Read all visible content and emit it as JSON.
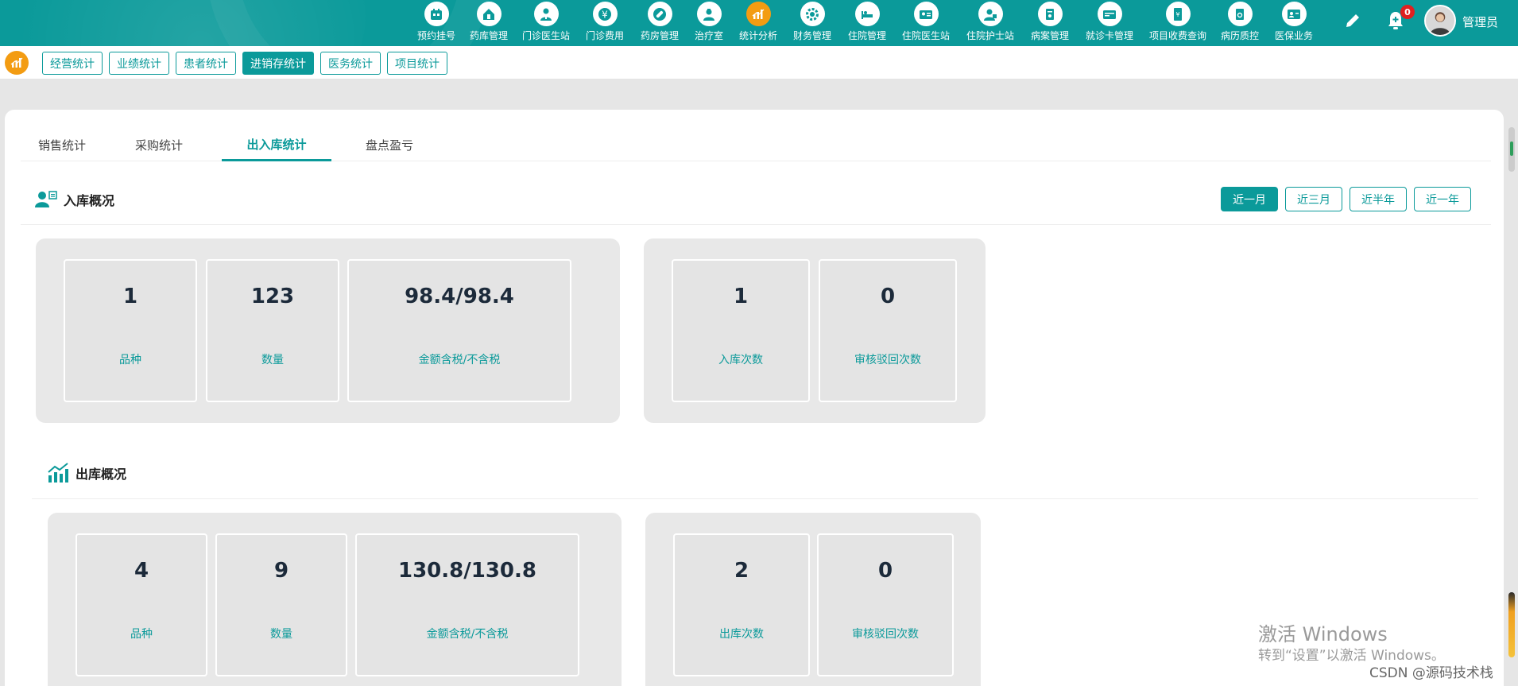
{
  "topnav": {
    "items": [
      {
        "label": "预约挂号",
        "icon": "calendar-icon"
      },
      {
        "label": "药库管理",
        "icon": "pill-house-icon"
      },
      {
        "label": "门诊医生站",
        "icon": "doctor-icon"
      },
      {
        "label": "门诊费用",
        "icon": "yuan-icon"
      },
      {
        "label": "药房管理",
        "icon": "capsule-icon"
      },
      {
        "label": "治疗室",
        "icon": "nurse-icon"
      },
      {
        "label": "统计分析",
        "icon": "chart-icon"
      },
      {
        "label": "财务管理",
        "icon": "gear-money-icon"
      },
      {
        "label": "住院管理",
        "icon": "bed-icon"
      },
      {
        "label": "住院医生站",
        "icon": "id-card-icon"
      },
      {
        "label": "住院护士站",
        "icon": "nurse-badge-icon"
      },
      {
        "label": "病案管理",
        "icon": "record-icon"
      },
      {
        "label": "就诊卡管理",
        "icon": "card-icon"
      },
      {
        "label": "项目收费查询",
        "icon": "invoice-icon"
      },
      {
        "label": "病历质控",
        "icon": "folder-check-icon"
      },
      {
        "label": "医保业务",
        "icon": "insurance-icon"
      }
    ],
    "active_index": 6,
    "notification_count": "0",
    "username": "管理员"
  },
  "subnav": {
    "tabs": [
      "经营统计",
      "业绩统计",
      "患者统计",
      "进销存统计",
      "医务统计",
      "项目统计"
    ],
    "active_index": 3
  },
  "tabs": [
    "销售统计",
    "采购统计",
    "出入库统计",
    "盘点盈亏"
  ],
  "active_tab": 2,
  "inbound": {
    "title": "入库概况",
    "cards_a": [
      {
        "value": "1",
        "label": "品种"
      },
      {
        "value": "123",
        "label": "数量"
      },
      {
        "value": "98.4/98.4",
        "label": "金额含税/不含税"
      }
    ],
    "cards_b": [
      {
        "value": "1",
        "label": "入库次数"
      },
      {
        "value": "0",
        "label": "审核驳回次数"
      }
    ]
  },
  "outbound": {
    "title": "出库概况",
    "cards_a": [
      {
        "value": "4",
        "label": "品种"
      },
      {
        "value": "9",
        "label": "数量"
      },
      {
        "value": "130.8/130.8",
        "label": "金额含税/不含税"
      }
    ],
    "cards_b": [
      {
        "value": "2",
        "label": "出库次数"
      },
      {
        "value": "0",
        "label": "审核驳回次数"
      }
    ]
  },
  "range_buttons": [
    "近一月",
    "近三月",
    "近半年",
    "近一年"
  ],
  "range_active": 0,
  "watermark": {
    "line1": "激活 Windows",
    "line2": "转到“设置”以激活 Windows。"
  },
  "csdn": "CSDN @源码技术栈",
  "colors": {
    "primary": "#0b9a9a",
    "accent": "#f39c12",
    "badge": "#e02020"
  }
}
